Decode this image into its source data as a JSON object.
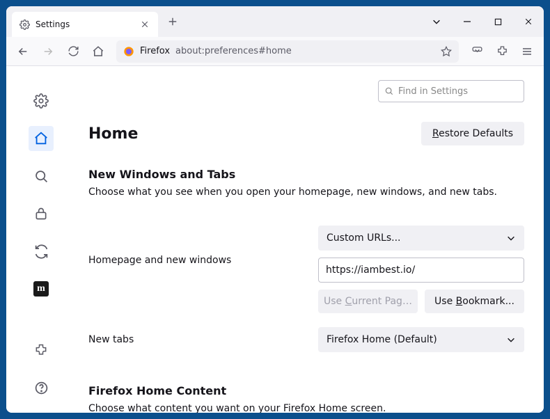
{
  "tab": {
    "title": "Settings"
  },
  "urlbar": {
    "product": "Firefox",
    "path": "about:preferences#home"
  },
  "search": {
    "placeholder": "Find in Settings"
  },
  "page": {
    "title": "Home",
    "restore": "Restore Defaults",
    "section1_title": "New Windows and Tabs",
    "section1_desc": "Choose what you see when you open your homepage, new windows, and new tabs.",
    "homepage_label": "Homepage and new windows",
    "homepage_select": "Custom URLs...",
    "homepage_value": "https://iambest.io/",
    "use_current": "Use Current Pages",
    "use_bookmark": "Use Bookmark...",
    "newtabs_label": "New tabs",
    "newtabs_select": "Firefox Home (Default)",
    "section2_title": "Firefox Home Content",
    "section2_desc": "Choose what content you want on your Firefox Home screen."
  }
}
